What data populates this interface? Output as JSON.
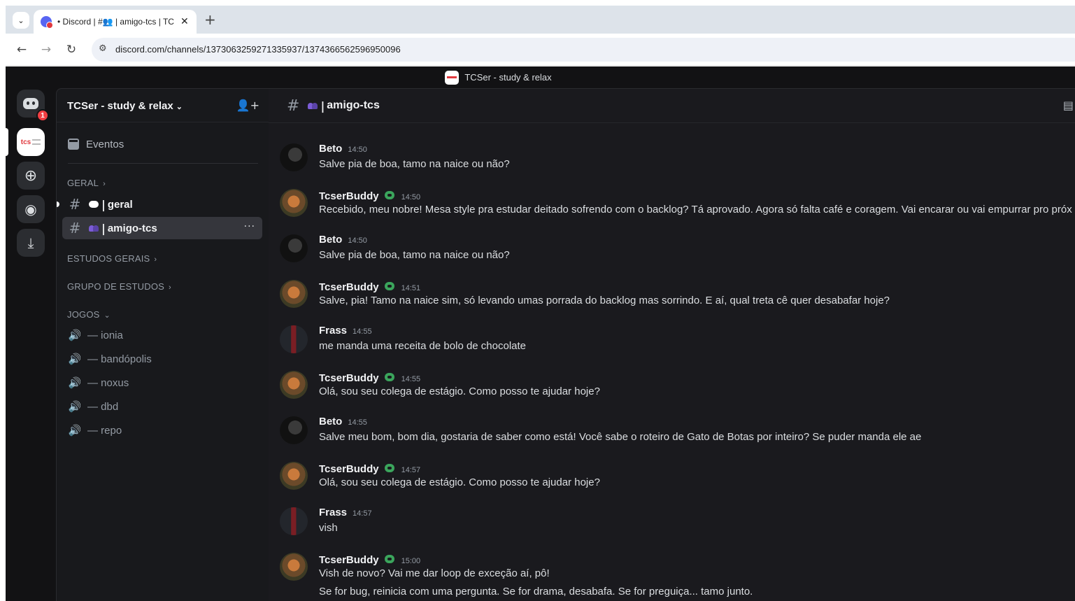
{
  "browser": {
    "tab_title": "• Discord | #👥 | amigo-tcs | TC",
    "tab_close": "✕",
    "new_tab": "+",
    "url": "discord.com/channels/1373063259271335937/1374366562596950096"
  },
  "topbar": {
    "title": "TCSer - study & relax"
  },
  "guilds": {
    "home_badge": "1",
    "tcs_text": "tcs"
  },
  "server": {
    "name": "TCSer - study & relax",
    "events_label": "Eventos"
  },
  "categories": {
    "geral": "GERAL",
    "estudos": "ESTUDOS GERAIS",
    "grupo": "GRUPO DE ESTUDOS",
    "jogos": "JOGOS"
  },
  "channels": [
    {
      "name": "geral"
    },
    {
      "name": "amigo-tcs"
    }
  ],
  "voice_channels": [
    {
      "name": "— ionia"
    },
    {
      "name": "— bandópolis"
    },
    {
      "name": "— noxus"
    },
    {
      "name": "— dbd"
    },
    {
      "name": "— repo"
    }
  ],
  "chat": {
    "channel_name": "amigo-tcs",
    "messages": [
      {
        "author": "Beto",
        "time": "14:50",
        "lines": [
          "Salve pia de boa, tamo na naice ou não?"
        ]
      },
      {
        "author": "TcserBuddy",
        "time": "14:50",
        "lines": [
          "Recebido, meu nobre! Mesa style pra estudar deitado sofrendo com o backlog? Tá aprovado. Agora só falta café e coragem. Vai encarar ou vai empurrar pro próx"
        ]
      },
      {
        "author": "Beto",
        "time": "14:50",
        "lines": [
          "Salve pia de boa, tamo na naice ou não?"
        ]
      },
      {
        "author": "TcserBuddy",
        "time": "14:51",
        "lines": [
          "Salve, pia! Tamo na naice sim, só levando umas porrada do backlog mas sorrindo. E aí, qual treta cê quer desabafar hoje?"
        ]
      },
      {
        "author": "Frass",
        "time": "14:55",
        "lines": [
          "me manda uma receita de bolo de chocolate"
        ]
      },
      {
        "author": "TcserBuddy",
        "time": "14:55",
        "lines": [
          "Olá, sou seu colega de estágio. Como posso te ajudar hoje?"
        ]
      },
      {
        "author": "Beto",
        "time": "14:55",
        "lines": [
          "Salve meu bom, bom dia, gostaria de saber como está! Você sabe o roteiro de Gato de Botas por inteiro? Se puder manda ele ae"
        ]
      },
      {
        "author": "TcserBuddy",
        "time": "14:57",
        "lines": [
          "Olá, sou seu colega de estágio. Como posso te ajudar hoje?"
        ]
      },
      {
        "author": "Frass",
        "time": "14:57",
        "lines": [
          "vish"
        ]
      },
      {
        "author": "TcserBuddy",
        "time": "15:00",
        "lines": [
          "Vish de novo? Vai me dar loop de exceção aí, pô!",
          "Se for bug, reinicia com uma pergunta. Se for drama, desabafa. Se for preguiça... tamo junto."
        ]
      }
    ]
  }
}
